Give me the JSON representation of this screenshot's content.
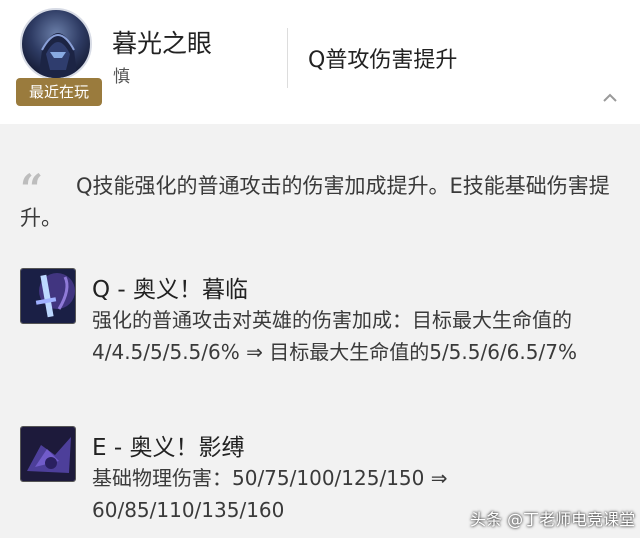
{
  "header": {
    "hero_name": "暮光之眼",
    "hero_role": "慎",
    "recent_badge": "最近在玩",
    "patch_title": "Q普攻伤害提升",
    "collapse_icon": "chevron-up-icon"
  },
  "summary": {
    "text": "Q技能强化的普通攻击的伤害加成提升。E技能基础伤害提升。",
    "quote_icon": "quote-icon"
  },
  "skills": [
    {
      "name": "Q - 奥义！暮临",
      "icon": "twilight-assault-skill-icon",
      "desc": "强化的普通攻击对英雄的伤害加成：目标最大生命值的4/4.5/5/5.5/6% ⇒ 目标最大生命值的5/5.5/6/6.5/7%"
    },
    {
      "name": "E - 奥义！影缚",
      "icon": "shadow-dash-skill-icon",
      "desc": "基础物理伤害：50/75/100/125/150 ⇒ 60/85/110/135/160"
    }
  ],
  "watermark": "头条 @丁老师电竞课堂",
  "colors": {
    "badge": "#9a7b3d",
    "panel_bg": "#f2f2f2",
    "header_bg": "#ffffff"
  }
}
